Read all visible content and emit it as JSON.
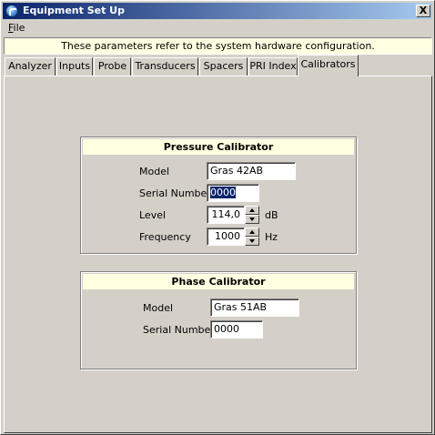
{
  "window": {
    "title": "Equipment Set Up",
    "close_label": "X"
  },
  "menu": {
    "file_label": "File",
    "file_mnemonic": "F",
    "file_rest": "ile"
  },
  "info_text": "These parameters refer to the system hardware configuration.",
  "tabs": [
    {
      "label": "Analyzer"
    },
    {
      "label": "Inputs"
    },
    {
      "label": "Probe"
    },
    {
      "label": "Transducers"
    },
    {
      "label": "Spacers"
    },
    {
      "label": "PRI Index"
    },
    {
      "label": "Calibrators",
      "active": true
    }
  ],
  "pressure_calibrator": {
    "title": "Pressure Calibrator",
    "model_label": "Model",
    "model_value": "Gras 42AB",
    "serial_label": "Serial Number",
    "serial_value": "0000",
    "level_label": "Level",
    "level_value": "114,0",
    "level_unit": "dB",
    "frequency_label": "Frequency",
    "frequency_value": "1000",
    "frequency_unit": "Hz"
  },
  "phase_calibrator": {
    "title": "Phase Calibrator",
    "model_label": "Model",
    "model_value": "Gras 51AB",
    "serial_label": "Serial Number",
    "serial_value": "0000"
  },
  "icons": [
    "app-globe-icon",
    "close-icon",
    "spin-up-icon",
    "spin-down-icon"
  ]
}
